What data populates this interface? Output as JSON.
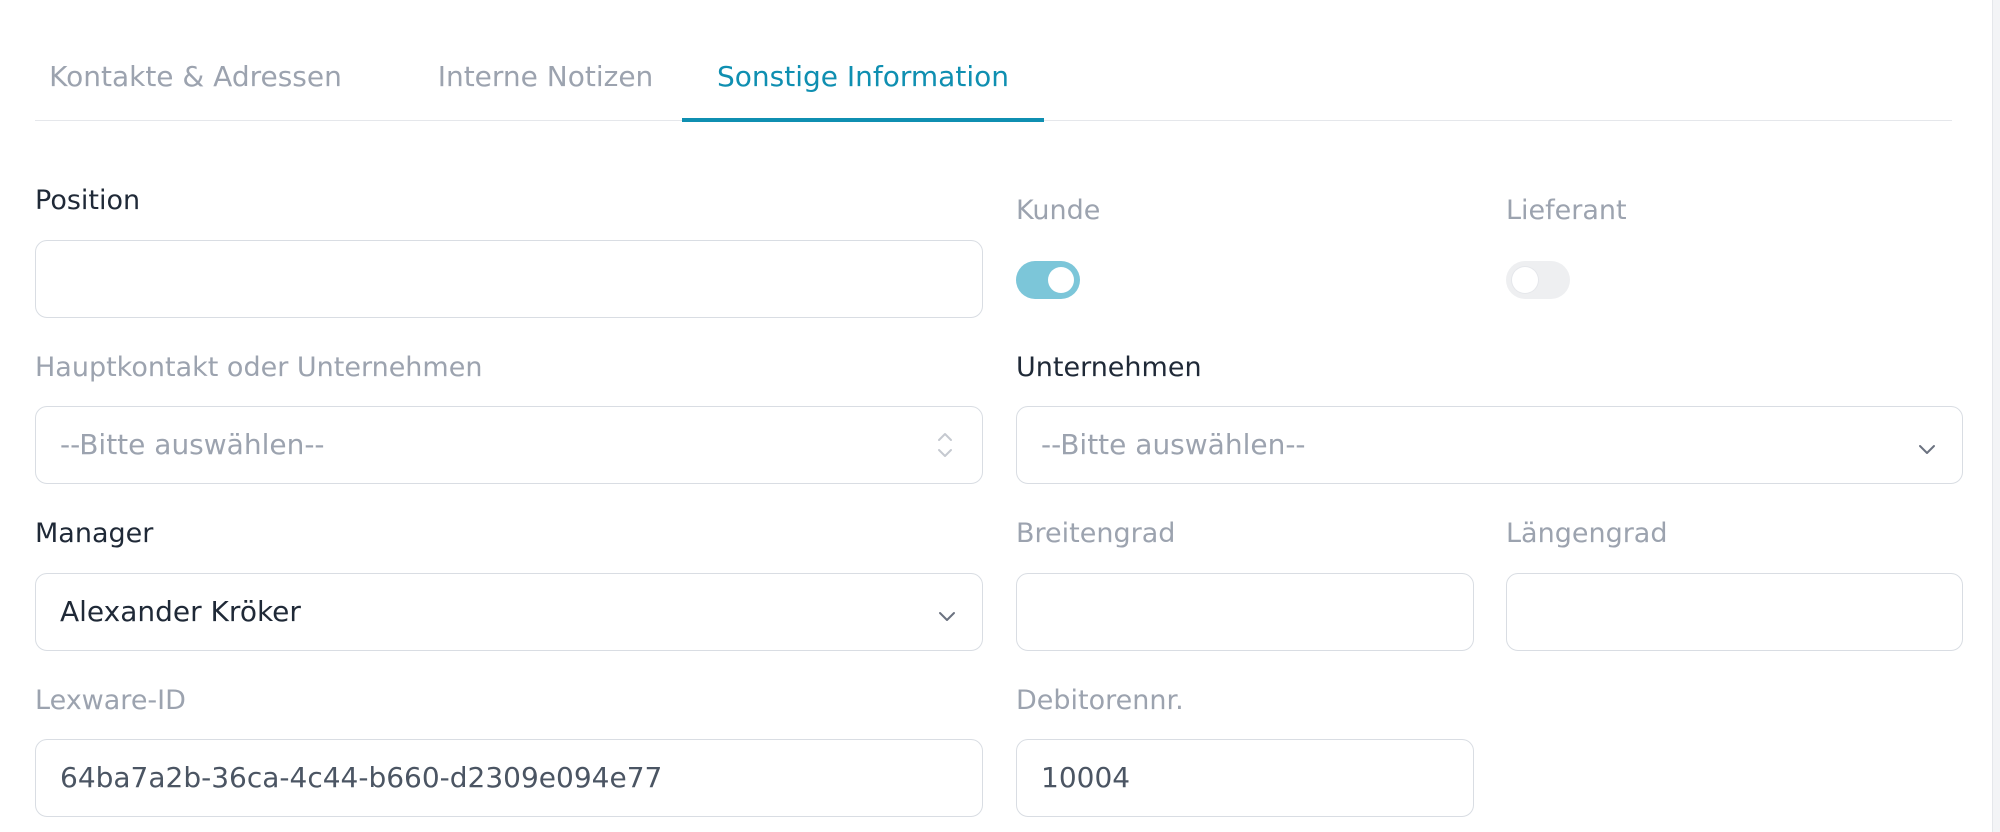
{
  "tabs": [
    {
      "label": "Kontakte & Adressen"
    },
    {
      "label": "Interne Notizen"
    },
    {
      "label": "Sonstige Information",
      "active": true
    }
  ],
  "form": {
    "position": {
      "label": "Position",
      "value": ""
    },
    "kunde": {
      "label": "Kunde",
      "checked": true
    },
    "lieferant": {
      "label": "Lieferant",
      "checked": false
    },
    "hauptkontakt": {
      "label": "Hauptkontakt oder Unternehmen",
      "placeholder": "--Bitte auswählen--"
    },
    "unternehmen": {
      "label": "Unternehmen",
      "placeholder": "--Bitte auswählen--"
    },
    "manager": {
      "label": "Manager",
      "value": "Alexander Kröker"
    },
    "breitengrad": {
      "label": "Breitengrad",
      "value": ""
    },
    "laengengrad": {
      "label": "Längengrad",
      "value": ""
    },
    "lexware_id": {
      "label": "Lexware-ID",
      "value": "64ba7a2b-36ca-4c44-b660-d2309e094e77"
    },
    "debitorennr": {
      "label": "Debitorennr.",
      "value": "10004"
    }
  },
  "colors": {
    "accent": "#0f8fb1",
    "toggle_on": "#7cc6d9",
    "muted_text": "#9ca3af",
    "border": "#d9dde3"
  },
  "icons": {
    "select_chevron": "chevron-down-icon",
    "select_updown": "chevron-up-down-icon"
  }
}
